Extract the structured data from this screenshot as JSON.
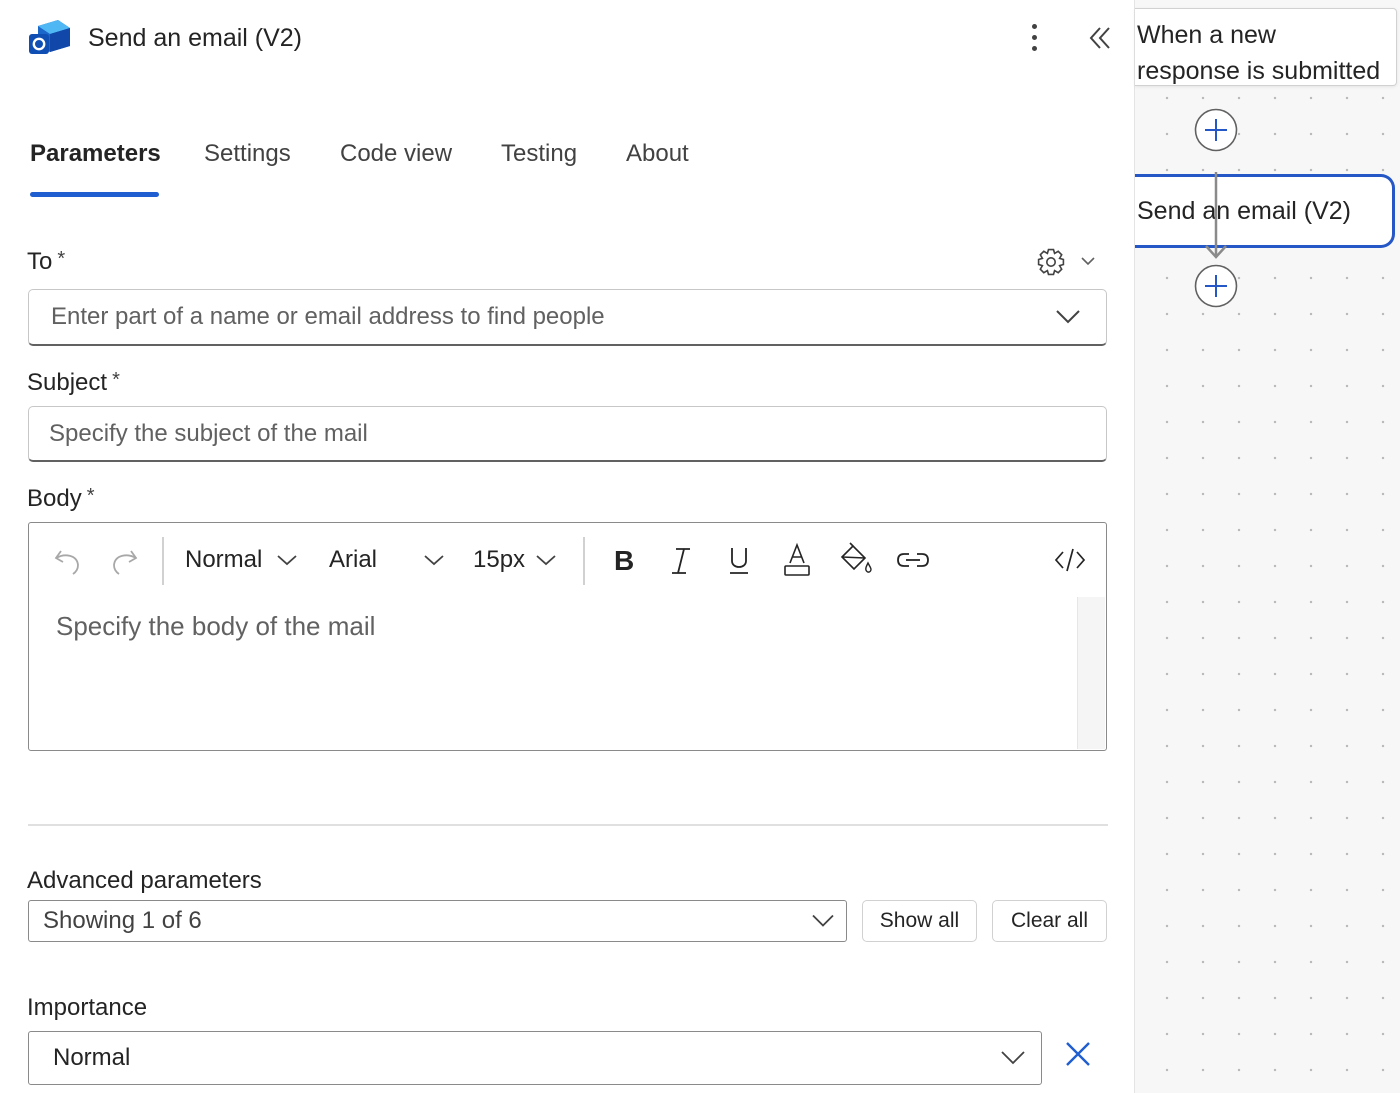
{
  "header": {
    "title": "Send an email (V2)",
    "app_icon": "outlook-icon",
    "more_icon": "more-vertical-icon",
    "collapse_icon": "double-chevron-left-icon"
  },
  "tabs": [
    {
      "label": "Parameters",
      "active": true
    },
    {
      "label": "Settings",
      "active": false
    },
    {
      "label": "Code view",
      "active": false
    },
    {
      "label": "Testing",
      "active": false
    },
    {
      "label": "About",
      "active": false
    }
  ],
  "fields": {
    "to": {
      "label": "To",
      "required": "*",
      "placeholder": "Enter part of a name or email address to find people"
    },
    "subject": {
      "label": "Subject",
      "required": "*",
      "placeholder": "Specify the subject of the mail"
    },
    "body": {
      "label": "Body",
      "required": "*",
      "placeholder": "Specify the body of the mail"
    }
  },
  "editor_toolbar": {
    "paragraph_style": "Normal",
    "font": "Arial",
    "font_size": "15px",
    "icons": [
      "undo-icon",
      "redo-icon",
      "bold-icon",
      "italic-icon",
      "underline-icon",
      "font-color-icon",
      "highlight-color-icon",
      "link-icon",
      "code-view-icon"
    ]
  },
  "advanced": {
    "label": "Advanced parameters",
    "value": "Showing 1 of 6",
    "show_all_label": "Show all",
    "clear_all_label": "Clear all"
  },
  "importance": {
    "label": "Importance",
    "value": "Normal"
  },
  "canvas": {
    "trigger_line1": "When a new",
    "trigger_line2": "response is submitted",
    "action_label": "Send an email (V2)"
  },
  "colors": {
    "accent": "#1f5ed1",
    "selected_node_border": "#2557c6"
  }
}
